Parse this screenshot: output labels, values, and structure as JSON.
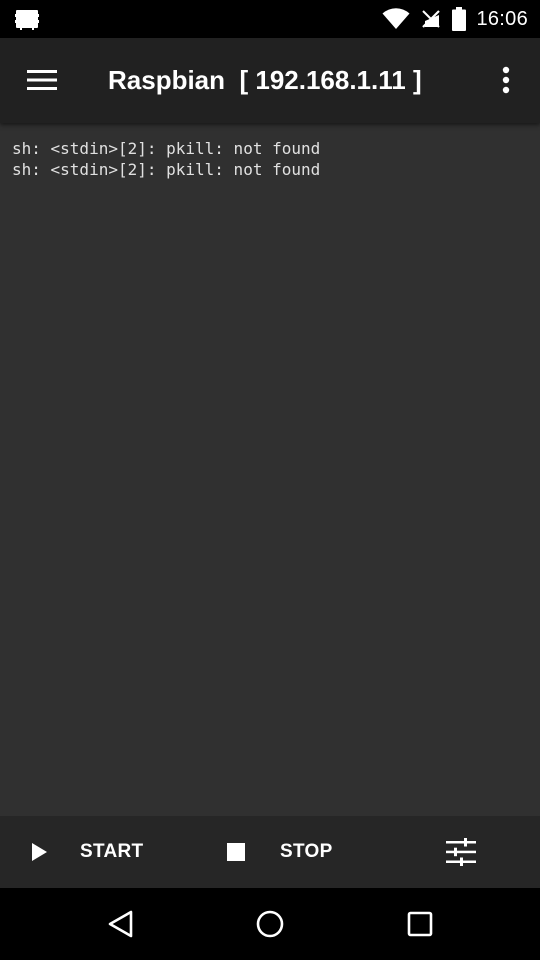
{
  "status_bar": {
    "time": "16:06",
    "icons": [
      "app-notification-icon",
      "wifi-icon",
      "no-sim-icon",
      "battery-icon"
    ]
  },
  "app_bar": {
    "title": "Raspbian  [ 192.168.1.11 ]",
    "icons": [
      "menu-icon",
      "more-vert-icon"
    ]
  },
  "console": {
    "lines": [
      "sh: <stdin>[2]: pkill: not found",
      "sh: <stdin>[2]: pkill: not found"
    ]
  },
  "toolbar": {
    "start_label": "START",
    "stop_label": "STOP",
    "icons": [
      "play-icon",
      "stop-icon",
      "tune-icon"
    ]
  },
  "nav_bar": {
    "icons": [
      "back-icon",
      "home-icon",
      "recents-icon"
    ]
  },
  "colors": {
    "app_bar": "#212121",
    "console_bg": "#303030",
    "toolbar_bg": "#262626",
    "text": "#ffffff"
  }
}
